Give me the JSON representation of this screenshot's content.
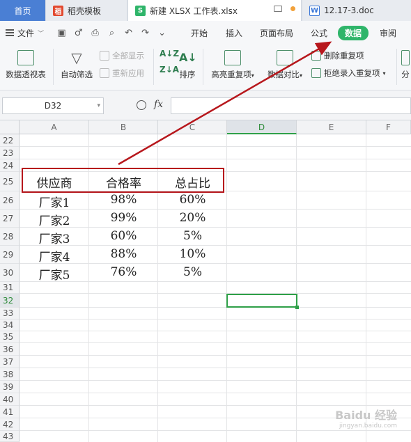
{
  "tabs": [
    {
      "label": "首页"
    },
    {
      "label": "稻壳模板"
    },
    {
      "label": "新建 XLSX 工作表.xlsx"
    },
    {
      "label": "12.17-3.doc"
    }
  ],
  "menu": {
    "file": "文件",
    "tabs": [
      "开始",
      "插入",
      "页面布局",
      "公式",
      "数据",
      "审阅"
    ],
    "active": "数据"
  },
  "ribbon": {
    "pivot": "数据透视表",
    "autofilter": "自动筛选",
    "show_all": "全部显示",
    "reapply": "重新应用",
    "sort": "排序",
    "highlight_dup": "高亮重复项",
    "compare": "数据对比",
    "remove_dup": "删除重复项",
    "reject_dup": "拒绝录入重复项",
    "split": "分"
  },
  "formula_bar": {
    "cell_ref": "D32",
    "fx": "fx",
    "formula": ""
  },
  "sheet": {
    "columns": [
      "A",
      "B",
      "C",
      "D",
      "E",
      "F"
    ],
    "selected_column": "D",
    "selected_row": "32",
    "rows": [
      "22",
      "23",
      "24",
      "25",
      "26",
      "27",
      "28",
      "29",
      "30",
      "31",
      "32",
      "33",
      "34",
      "35",
      "36",
      "37",
      "38",
      "39",
      "40",
      "41",
      "42",
      "43"
    ],
    "table_header": [
      "供应商",
      "合格率",
      "总占比"
    ],
    "table_rows": [
      [
        "厂家1",
        "98%",
        "60%"
      ],
      [
        "厂家2",
        "99%",
        "20%"
      ],
      [
        "厂家3",
        "60%",
        "5%"
      ],
      [
        "厂家4",
        "88%",
        "10%"
      ],
      [
        "厂家5",
        "76%",
        "5%"
      ]
    ]
  },
  "annotation": {
    "color": "#b7171c"
  },
  "watermark": {
    "brand": "Baidu 经验",
    "url": "jingyan.baidu.com"
  }
}
